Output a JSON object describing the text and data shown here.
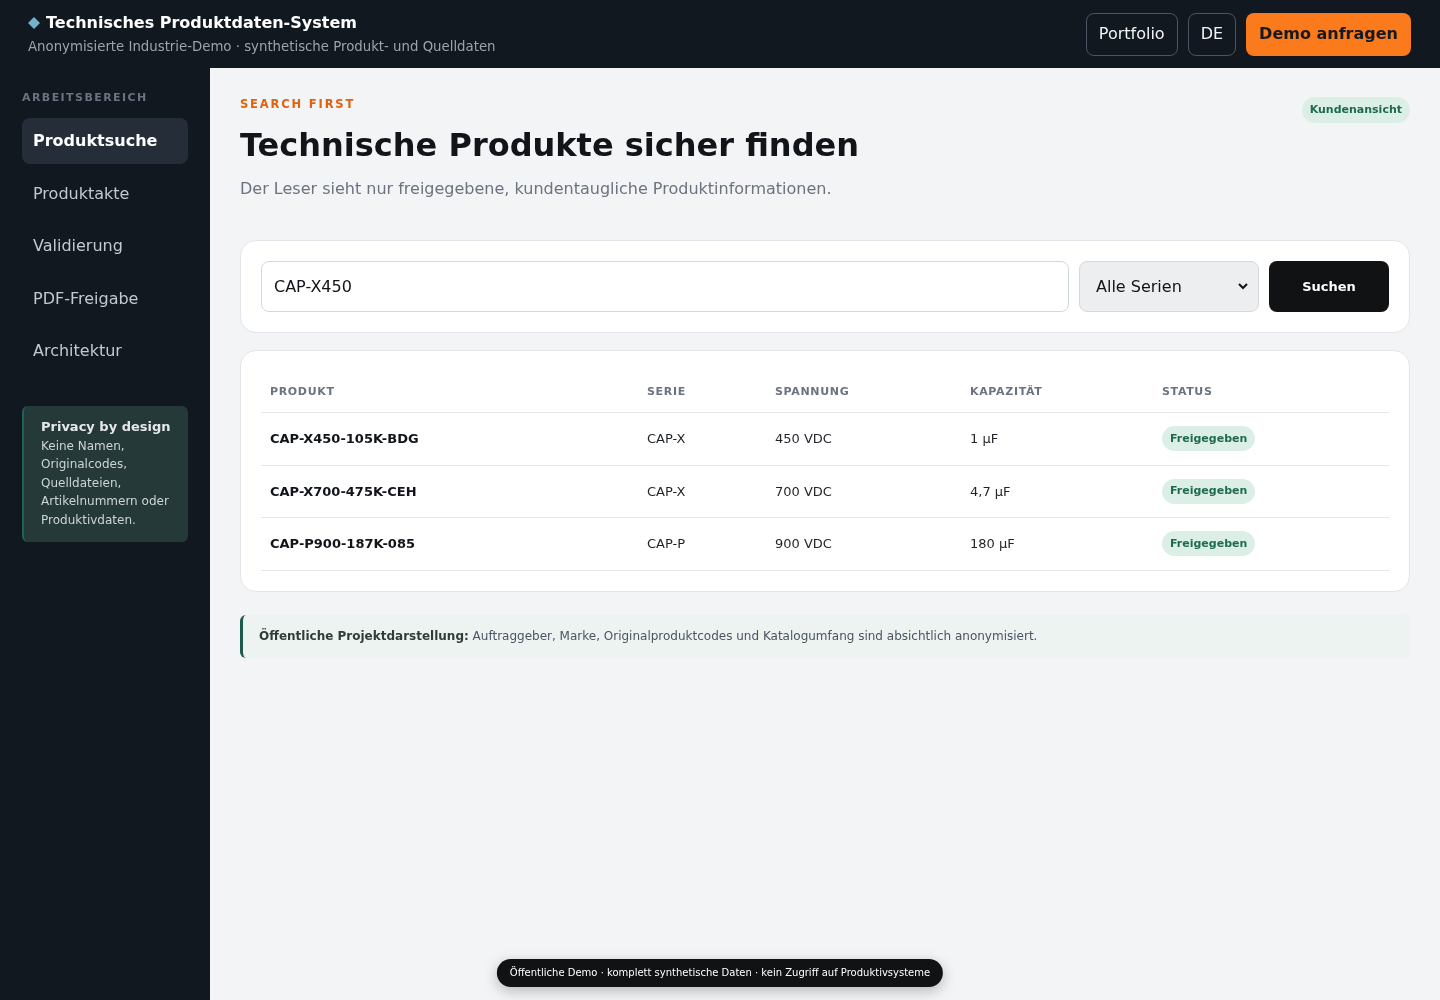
{
  "header": {
    "title": "Technisches Produktdaten-System",
    "subtitle": "Anonymisierte Industrie-Demo · synthetische Produkt- und Quelldaten",
    "buttons": [
      {
        "label": "Portfolio",
        "kind": "outline"
      },
      {
        "label": "DE",
        "kind": "outline"
      },
      {
        "label": "Demo anfragen",
        "kind": "primary"
      }
    ]
  },
  "sidebar": {
    "section_label": "ARBEITSBEREICH",
    "items": [
      {
        "label": "Produktsuche",
        "selected": true
      },
      {
        "label": "Produktakte",
        "selected": false
      },
      {
        "label": "Validierung",
        "selected": false
      },
      {
        "label": "PDF-Freigabe",
        "selected": false
      },
      {
        "label": "Architektur",
        "selected": false
      }
    ],
    "info_card": {
      "title": "Privacy by design",
      "text": "Keine Namen, Originalcodes, Quelldateien, Artikelnummern oder Produktivdaten."
    }
  },
  "page": {
    "eyebrow": "SEARCH FIRST",
    "title": "Technische Produkte sicher finden",
    "subtitle": "Der Leser sieht nur freigegebene, kundentaugliche Produktinformationen.",
    "badge": "Kundenansicht"
  },
  "search": {
    "value": "CAP-X450",
    "series_filter": "Alle Serien",
    "button": "Suchen"
  },
  "table": {
    "columns": [
      "PRODUKT",
      "SERIE",
      "SPANNUNG",
      "KAPAZITÄT",
      "STATUS"
    ],
    "rows": [
      {
        "cells": [
          "CAP-X450-105K-BDG",
          "CAP-X",
          "450 VDC",
          "1 µF"
        ],
        "status": "Freigegeben"
      },
      {
        "cells": [
          "CAP-X700-475K-CEH",
          "CAP-X",
          "700 VDC",
          "4,7 µF"
        ],
        "status": "Freigegeben"
      },
      {
        "cells": [
          "CAP-P900-187K-085",
          "CAP-P",
          "900 VDC",
          "180 µF"
        ],
        "status": "Freigegeben"
      }
    ]
  },
  "notice": "**Öffentliche Projektdarstellung:** Auftraggeber, Marke, Originalproduktcodes und Katalogumfang sind absichtlich anonymisiert.",
  "footer_banner": "Öffentliche Demo · komplett synthetische Daten · kein Zugriff auf Produktivsysteme"
}
